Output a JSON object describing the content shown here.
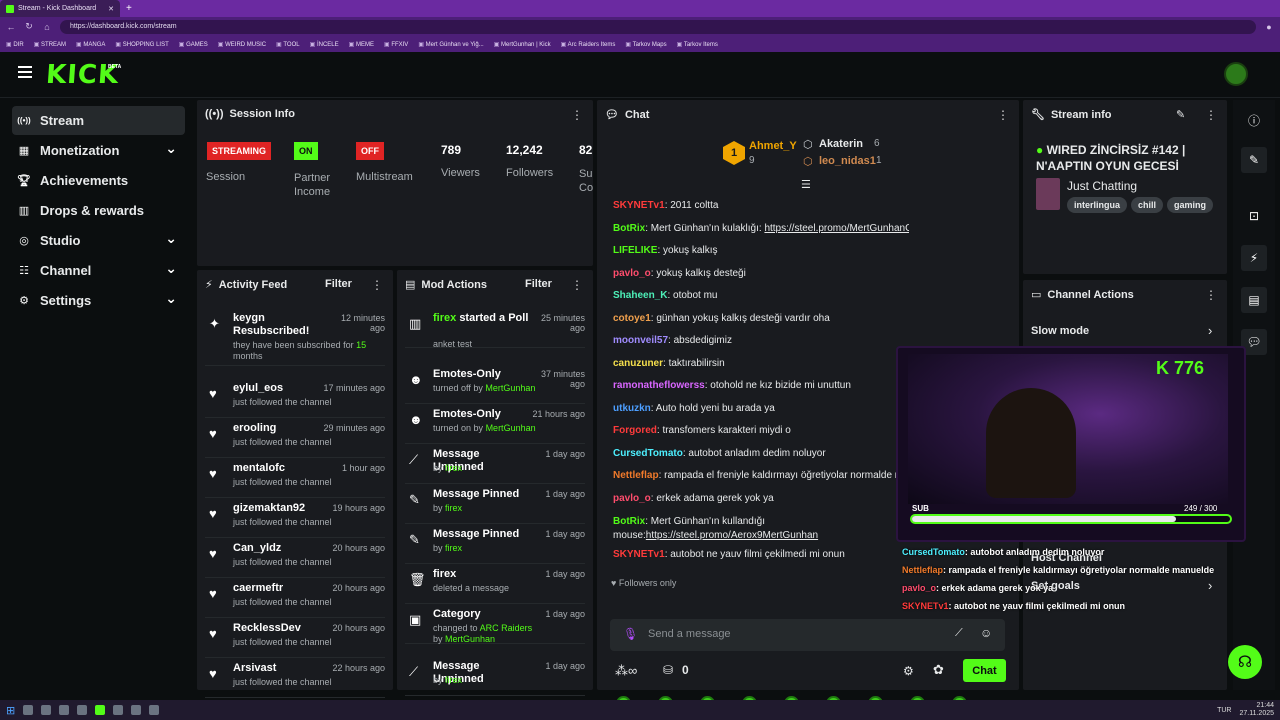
{
  "browser": {
    "tab_title": "Stream - Kick Dashboard",
    "url": "https://dashboard.kick.com/stream",
    "bookmarks": [
      "DIR",
      "STREAM",
      "MANGA",
      "SHOPPING LIST",
      "GAMES",
      "WEIRD MUSIC",
      "TOOL",
      "İNCELE",
      "MEME",
      "FFXIV",
      "Mert Günhan ve Yiğ...",
      "MertGunhan | Kick",
      "Arc Raiders Items",
      "Tarkov Maps",
      "Tarkov Items"
    ]
  },
  "header": {
    "logo": "KICK",
    "beta": "BETA"
  },
  "sidebar": {
    "items": [
      {
        "label": "Stream",
        "icon": "broadcast-icon"
      },
      {
        "label": "Monetization",
        "icon": "monetization-icon",
        "chev": "❯"
      },
      {
        "label": "Achievements",
        "icon": "trophy-icon"
      },
      {
        "label": "Drops & rewards",
        "icon": "gift-icon"
      },
      {
        "label": "Studio",
        "icon": "studio-icon",
        "chev": "❯"
      },
      {
        "label": "Channel",
        "icon": "channel-icon",
        "chev": "❯"
      },
      {
        "label": "Settings",
        "icon": "settings-icon",
        "chev": "❯"
      }
    ]
  },
  "session": {
    "title": "Session Info",
    "badges": [
      {
        "text": "STREAMING",
        "color": "#e02424"
      },
      {
        "text": "ON",
        "color": "#53fc18"
      },
      {
        "text": "OFF",
        "color": "#e02424"
      }
    ],
    "labels": [
      "Session",
      "Partner Income",
      "Multistream"
    ],
    "stats": [
      {
        "value": "789",
        "label": "Viewers"
      },
      {
        "value": "12,242",
        "label": "Followers"
      },
      {
        "value": "82",
        "label": "Su Co"
      }
    ]
  },
  "activity": {
    "title": "Activity Feed",
    "filter": "Filter",
    "items": [
      {
        "name": "keygn Resubscribed!",
        "sub": "they have been subscribed for",
        "months_num": "15",
        "months_word": "months",
        "time": "12 minutes ago"
      },
      {
        "name": "eylul_eos",
        "sub": "just followed the channel",
        "time": "17 minutes ago"
      },
      {
        "name": "erooling",
        "sub": "just followed the channel",
        "time": "29 minutes ago"
      },
      {
        "name": "mentalofc",
        "sub": "just followed the channel",
        "time": "1 hour ago"
      },
      {
        "name": "gizemaktan92",
        "sub": "just followed the channel",
        "time": "19 hours ago"
      },
      {
        "name": "Can_yldz",
        "sub": "just followed the channel",
        "time": "20 hours ago"
      },
      {
        "name": "caermeftr",
        "sub": "just followed the channel",
        "time": "20 hours ago"
      },
      {
        "name": "RecklessDev",
        "sub": "just followed the channel",
        "time": "20 hours ago"
      },
      {
        "name": "Arsivast",
        "sub": "just followed the channel",
        "time": "22 hours ago"
      }
    ]
  },
  "mod": {
    "title": "Mod Actions",
    "filter": "Filter",
    "items": [
      {
        "who": "firex",
        "what": "started a Poll",
        "sub": "anket test",
        "time": "25 minutes ago",
        "icon": "poll-icon"
      },
      {
        "what": "Emotes-Only",
        "sub": "turned off by",
        "by": "MertGunhan",
        "time": "37 minutes ago",
        "icon": "smile-icon"
      },
      {
        "what": "Emotes-Only",
        "sub": "turned on by",
        "by": "MertGunhan",
        "time": "21 hours ago",
        "icon": "smile-icon"
      },
      {
        "what": "Message Unpinned",
        "sub": "by",
        "by": "firex",
        "time": "1 day ago",
        "icon": "unpin-icon"
      },
      {
        "what": "Message Pinned",
        "sub": "by",
        "by": "firex",
        "time": "1 day ago",
        "icon": "pin-icon"
      },
      {
        "what": "Message Pinned",
        "sub": "by",
        "by": "firex",
        "time": "1 day ago",
        "icon": "pin-icon"
      },
      {
        "what": "firex",
        "sub": "deleted a message",
        "time": "1 day ago",
        "icon": "trash-icon"
      },
      {
        "what": "Category",
        "sub": "changed to",
        "cat": "ARC Raiders",
        "sub2": "by",
        "by": "MertGunhan",
        "time": "1 day ago",
        "icon": "category-icon"
      },
      {
        "what": "Message Unpinned",
        "sub": "by",
        "by": "firex",
        "time": "1 day ago",
        "icon": "unpin-icon"
      }
    ]
  },
  "chat": {
    "title": "Chat",
    "top": [
      {
        "rank": "1",
        "name": "Ahmet_Y",
        "count": "9"
      },
      {
        "name": "Akaterin",
        "count": "6"
      },
      {
        "name": "leo_nidas1",
        "count": "1"
      }
    ],
    "messages": [
      {
        "user": "SKYNETv1",
        "color": "#ff3b3b",
        "text": ": 2011 coltta"
      },
      {
        "user": "BotRix",
        "color": "#53fc18",
        "text": ": Mert Günhan'ın kulaklığı: ",
        "link": "https://steel.promo/MertGunhanGamebuds"
      },
      {
        "user": "LIFELIKE",
        "color": "#53fc18",
        "text": ": yokuş kalkış"
      },
      {
        "user": "pavlo_o",
        "color": "#ff4d6d",
        "text": ": yokuş kalkış desteği"
      },
      {
        "user": "Shaheen_K",
        "color": "#4df0b8",
        "text": ": otobot mu"
      },
      {
        "user": "cotoye1",
        "color": "#f0a04d",
        "text": ": günhan yokuş kalkış desteği vardır oha"
      },
      {
        "user": "moonveil57",
        "color": "#a08cff",
        "text": ": absdedigimiz"
      },
      {
        "user": "canuzuner",
        "color": "#f5e04d",
        "text": ": taktırabilirsin"
      },
      {
        "user": "ramonatheflowerss",
        "color": "#d966ff",
        "text": ": otohold ne kız bizide mi unuttun"
      },
      {
        "user": "utkuzkn",
        "color": "#4d9fff",
        "text": ": Auto hold yeni bu arada ya"
      },
      {
        "user": "Forgored",
        "color": "#ff3b3b",
        "text": ": transfomers karakteri miydi o"
      },
      {
        "user": "CursedTomato",
        "color": "#4df0ff",
        "text": ": autobot anladım dedim noluyor"
      },
      {
        "user": "Nettleflap",
        "color": "#f07a2b",
        "text": ": rampada el freniyle kaldırmayı öğretiyolar normalde manuelde"
      },
      {
        "user": "pavlo_o",
        "color": "#ff4d6d",
        "text": ": erkek adama gerek yok ya"
      },
      {
        "user": "BotRix",
        "color": "#53fc18",
        "text": ": Mert Günhan'ın kullandığı mouse:",
        "link": "https://steel.promo/Aerox9MertGunhan"
      },
      {
        "user": "SKYNETv1",
        "color": "#ff3b3b",
        "text": ": autobot ne yauv filmi çekilmedi mi onun"
      }
    ],
    "followers_only": "Followers only",
    "placeholder": "Send a message",
    "points": "0",
    "send": "Chat"
  },
  "streaminfo": {
    "title": "Stream info",
    "stream_title": "WIRED ZİNCİRSİZ #142 | N'AAPTIN OYUN GECESİ",
    "category": "Just Chatting",
    "tags": [
      "interlingua",
      "chill",
      "gaming"
    ]
  },
  "channel_actions": {
    "title": "Channel Actions",
    "slow_mode": "Slow mode",
    "host": "Host Channel",
    "goals": "Set goals"
  },
  "overlay": {
    "logo": "K 776",
    "sub": "SUB",
    "progress": "249 / 300",
    "progress_frac": 0.83
  },
  "overlay_chat": [
    {
      "user": "CursedTomato",
      "color": "#4df0ff",
      "text": ": autobot anladım dedim noluyor"
    },
    {
      "user": "Nettleflap",
      "color": "#f07a2b",
      "text": ": rampada el freniyle kaldırmayı öğretiyolar normalde manuelde"
    },
    {
      "user": "pavlo_o",
      "color": "#ff4d6d",
      "text": ": erkek adama gerek yok ya"
    },
    {
      "user": "SKYNETv1",
      "color": "#ff3b3b",
      "text": ": autobot ne yauv filmi çekilmedi mi onun"
    }
  ],
  "taskbar": {
    "lang": "TUR",
    "time": "21:44",
    "date": "27.11.2025"
  }
}
